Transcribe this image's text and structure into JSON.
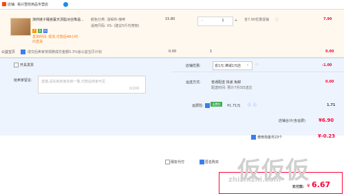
{
  "shop": {
    "label": "店铺:",
    "name": "易兴雪姣用品专营店"
  },
  "item": {
    "title": "演商链子睡瓷蔓天漂脂冰丝降温...",
    "tags": [
      "7",
      "金",
      "吗"
    ],
    "promo1": "发货时间:  现货,付款后48小时",
    "promo2": "内发货",
    "attr_color": "颜色分类:  浅褐布-咖啡",
    "attr_size": "适用尺码:  XS-  (建议5斤内宠物)",
    "unit_price": "15.80",
    "qty": "1",
    "qty_minus": "−",
    "qty_plus": "+",
    "discount": "省7.90优惠促销",
    "total": "7.90"
  },
  "charity": {
    "label": "公益宝贝",
    "text": "成交后卖家将捐赠成交金额0.3%给公益宝贝计划",
    "price": "0.00",
    "qty": "1",
    "total": "0.00"
  },
  "invoice": {
    "label": "开具发票"
  },
  "message": {
    "label": "给卖家留言:",
    "placeholder": "选填,请先和商家协商一致,付款后商家可见",
    "count": "0/200"
  },
  "shop_discount": {
    "label": "店铺优惠:",
    "option": "省1元:满减1元店",
    "amount": "-1.00"
  },
  "delivery": {
    "label": "运送方式:",
    "method": "普通配送 快递 免邮",
    "date": "配送时间: 预计7月3日送达",
    "fee": "0.00"
  },
  "insurance": {
    "label": "运费险:",
    "badge": "运费险",
    "text": "¥1.71元",
    "amount": "1.71"
  },
  "shop_total": {
    "label": "店铺合计(含运费)",
    "amount": "¥6.90"
  },
  "coupon": {
    "label": "使用淘金币23个",
    "amount": "¥-0.23"
  },
  "options": {
    "anon": "匿名购买",
    "friend_pay": "朋友代付"
  },
  "payment": {
    "label": "实付款:",
    "currency": "¥",
    "amount": "6.67"
  },
  "watermark": "zhizhizhi.com",
  "colors": {
    "accent": "#ff0036",
    "blue": "#3b7cf0",
    "pane": "#eef4fd",
    "order": "#fff8ef"
  }
}
